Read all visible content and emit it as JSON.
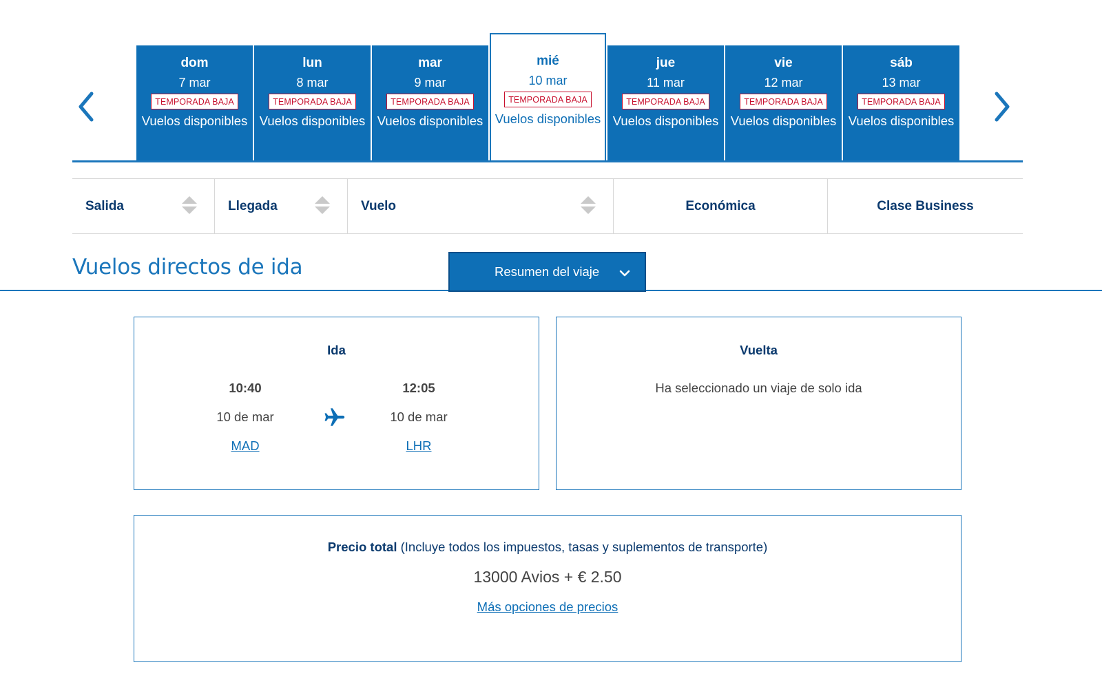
{
  "day_strip": {
    "days": [
      {
        "name": "dom",
        "date": "7 mar",
        "badge": "TEMPORADA BAJA",
        "availability": "Vuelos disponibles",
        "selected": false
      },
      {
        "name": "lun",
        "date": "8 mar",
        "badge": "TEMPORADA BAJA",
        "availability": "Vuelos disponibles",
        "selected": false
      },
      {
        "name": "mar",
        "date": "9 mar",
        "badge": "TEMPORADA BAJA",
        "availability": "Vuelos disponibles",
        "selected": false
      },
      {
        "name": "mié",
        "date": "10 mar",
        "badge": "TEMPORADA BAJA",
        "availability": "Vuelos disponibles",
        "selected": true
      },
      {
        "name": "jue",
        "date": "11 mar",
        "badge": "TEMPORADA BAJA",
        "availability": "Vuelos disponibles",
        "selected": false
      },
      {
        "name": "vie",
        "date": "12 mar",
        "badge": "TEMPORADA BAJA",
        "availability": "Vuelos disponibles",
        "selected": false
      },
      {
        "name": "sáb",
        "date": "13 mar",
        "badge": "TEMPORADA BAJA",
        "availability": "Vuelos disponibles",
        "selected": false
      }
    ],
    "prev_icon": "chevron-left-icon",
    "next_icon": "chevron-right-icon"
  },
  "columns": {
    "salida": "Salida",
    "llegada": "Llegada",
    "vuelo": "Vuelo",
    "economica": "Económica",
    "business": "Clase Business",
    "sort_icon": "sort-icon"
  },
  "section": {
    "title": "Vuelos directos de ida",
    "summary_button": "Resumen del viaje",
    "summary_icon": "chevron-down-icon"
  },
  "ida": {
    "title": "Ida",
    "departure": {
      "time": "10:40",
      "date": "10 de mar",
      "airport": "MAD"
    },
    "arrival": {
      "time": "12:05",
      "date": "10 de mar",
      "airport": "LHR"
    },
    "icon": "airplane-icon"
  },
  "vuelta": {
    "title": "Vuelta",
    "message": "Ha seleccionado un viaje de solo ida"
  },
  "price": {
    "label": "Precio total",
    "note": "(Incluye todos los impuestos, tasas y suplementos de transporte)",
    "amount": "13000 Avios + € 2.50",
    "more_link": "Más opciones de precios"
  },
  "colors": {
    "primary": "#0e6fb6",
    "accent_line": "#1b76bb",
    "dark_text": "#0b3a6e",
    "badge_red": "#c8102e"
  }
}
